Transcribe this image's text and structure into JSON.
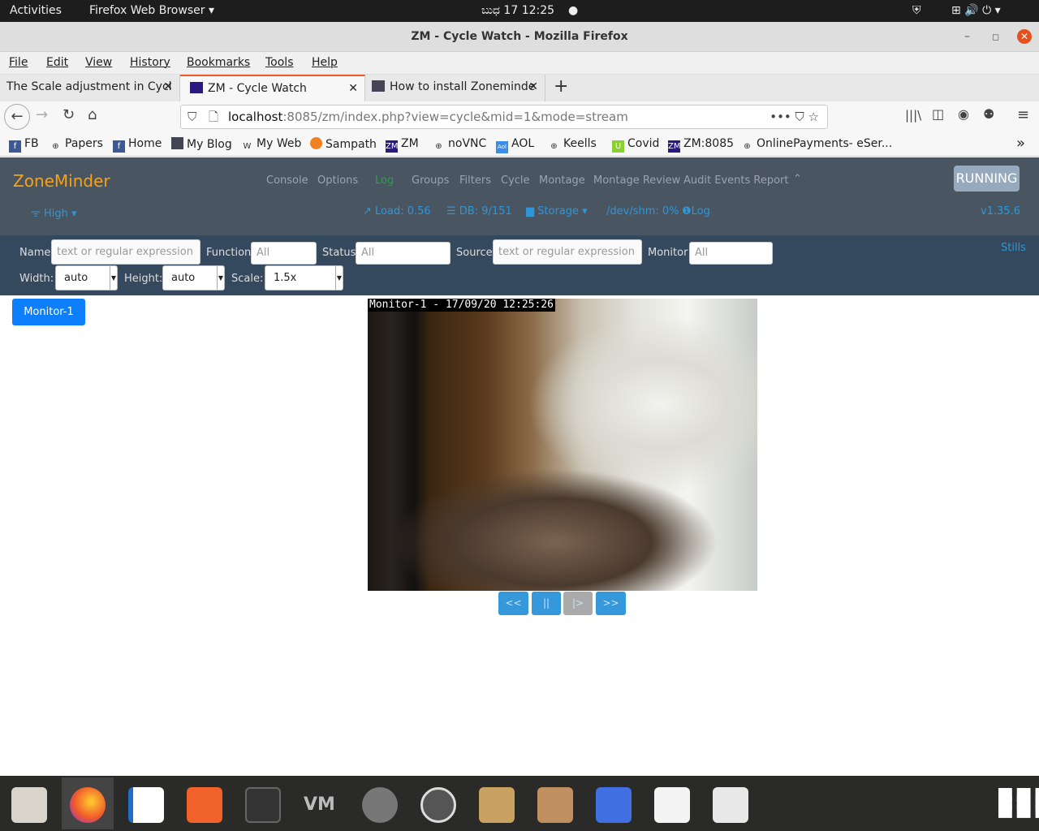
{
  "system": {
    "activities": "Activities",
    "app_menu": "Firefox Web Browser ▾",
    "clock": "ಬುಧ 17  12:25"
  },
  "window": {
    "title": "ZM - Cycle Watch - Mozilla Firefox"
  },
  "menu": [
    "File",
    "Edit",
    "View",
    "History",
    "Bookmarks",
    "Tools",
    "Help"
  ],
  "tabs": [
    {
      "label": "The Scale adjustment in Cycl"
    },
    {
      "label": "ZM - Cycle Watch"
    },
    {
      "label": "How to install Zoneminde"
    }
  ],
  "address": {
    "host": "localhost",
    "rest": ":8085/zm/index.php?view=cycle&mid=1&mode=stream"
  },
  "bookmarks": [
    "FB",
    "Papers",
    "Home",
    "My Blog",
    "My Web",
    "Sampath",
    "ZM",
    "noVNC",
    "AOL",
    "Keells",
    "Covid",
    "ZM:8085",
    "OnlinePayments- eSer..."
  ],
  "zm": {
    "brand": "ZoneMinder",
    "nav": [
      "Console",
      "Options",
      "Log",
      "Groups",
      "Filters",
      "Cycle",
      "Montage",
      "Montage Review",
      "Audit Events Report"
    ],
    "bandwidth": "High",
    "load": "Load: 0.56",
    "db": "DB: 9/151",
    "storage": "Storage",
    "shm": "/dev/shm: 0%",
    "log": "Log",
    "version": "v1.35.6",
    "state": "RUNNING",
    "log_color": "#2f9e44",
    "brand_color": "#f4a316"
  },
  "filters": {
    "name_label": "Name",
    "name_placeholder": "text or regular expression",
    "function_label": "Function",
    "function_value": "All",
    "status_label": "Status",
    "status_value": "All",
    "source_label": "Source",
    "source_placeholder": "text or regular expression",
    "monitor_label": "Monitor",
    "monitor_value": "All",
    "stills": "Stills",
    "width_label": "Width:",
    "width_value": "auto",
    "height_label": "Height:",
    "height_value": "auto",
    "scale_label": "Scale:",
    "scale_value": "1.5x"
  },
  "monitor_button": "Monitor-1",
  "stream": {
    "overlay": "Monitor-1 - 17/09/20 12:25:26"
  },
  "controls": {
    "prev": "<<",
    "pause": "||",
    "play": "|>",
    "next": ">>"
  }
}
